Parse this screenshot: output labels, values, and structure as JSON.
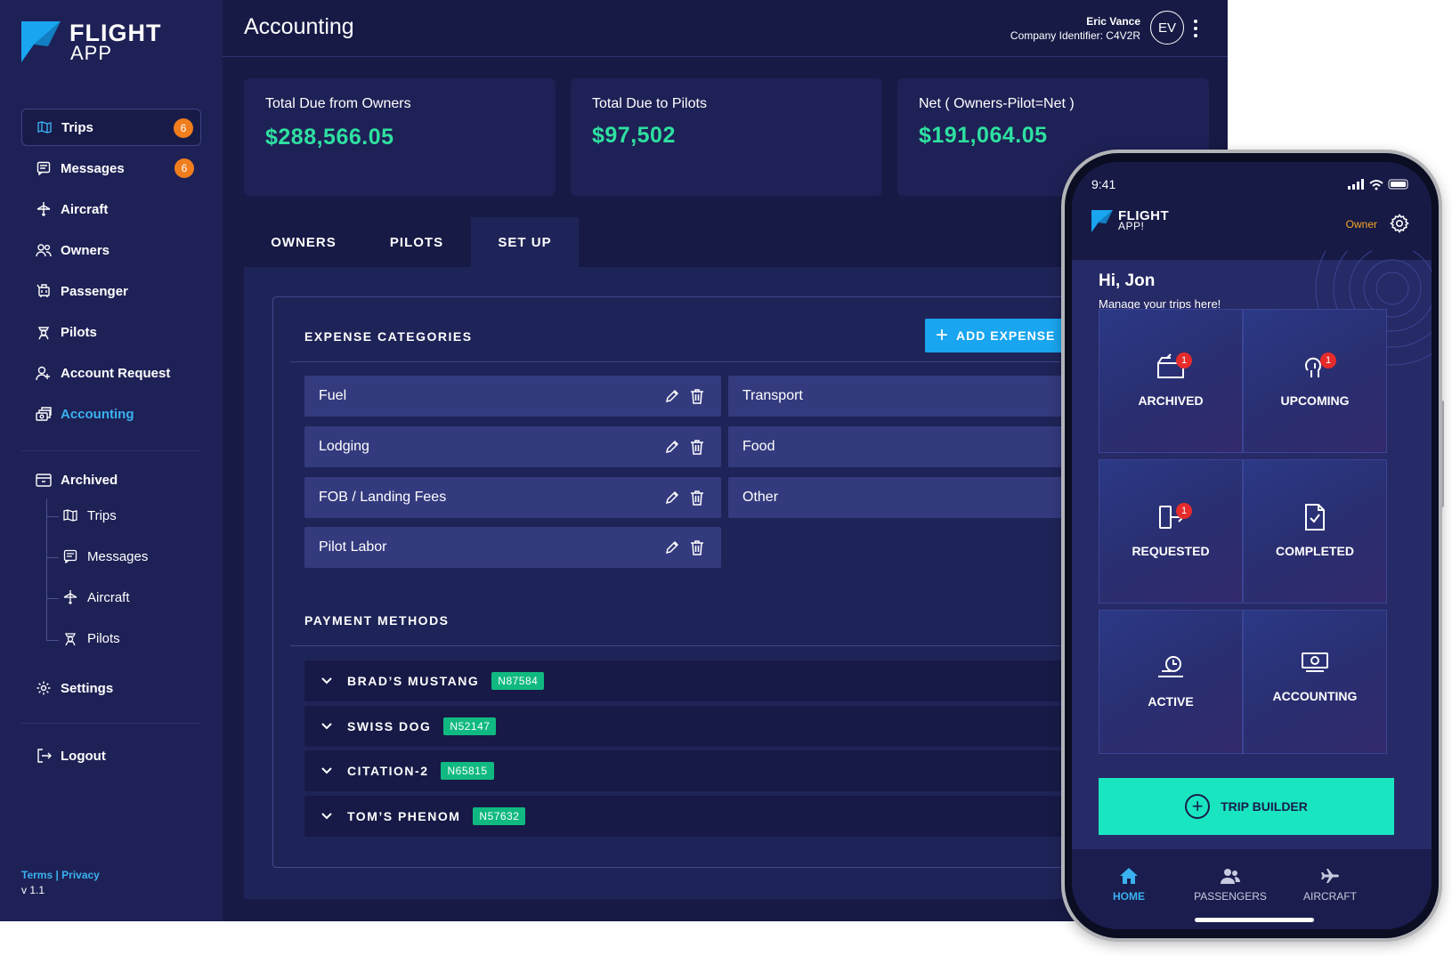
{
  "app": {
    "logo_line1": "FLIGHT",
    "logo_line2": "APP"
  },
  "sidebar": {
    "items": [
      {
        "label": "Trips",
        "badge": "6"
      },
      {
        "label": "Messages",
        "badge": "6"
      },
      {
        "label": "Aircraft"
      },
      {
        "label": "Owners"
      },
      {
        "label": "Passenger"
      },
      {
        "label": "Pilots"
      },
      {
        "label": "Account Request"
      },
      {
        "label": "Accounting"
      }
    ],
    "archived": {
      "label": "Archived",
      "children": [
        "Trips",
        "Messages",
        "Aircraft",
        "Pilots"
      ]
    },
    "settings": "Settings",
    "logout": "Logout",
    "footer_links": "Terms | Privacy",
    "version": "v 1.1"
  },
  "header": {
    "title": "Accounting",
    "user_name": "Eric Vance",
    "company_id": "Company Identifier: C4V2R",
    "avatar": "EV"
  },
  "stats": [
    {
      "label": "Total Due from Owners",
      "value": "$288,566.05"
    },
    {
      "label": "Total Due to Pilots",
      "value": "$97,502"
    },
    {
      "label": "Net  ( Owners-Pilot=Net )",
      "value": "$191,064.05"
    }
  ],
  "tabs": [
    "OWNERS",
    "PILOTS",
    "SET UP"
  ],
  "expense": {
    "title": "EXPENSE CATEGORIES",
    "add_button": "ADD EXPENSE",
    "left": [
      "Fuel",
      "Lodging",
      "FOB / Landing Fees",
      "Pilot Labor"
    ],
    "right": [
      "Transport",
      "Food",
      "Other"
    ]
  },
  "payment": {
    "title": "PAYMENT METHODS",
    "rows": [
      {
        "name": "BRAD’S MUSTANG",
        "tail": "N87584"
      },
      {
        "name": "SWISS DOG",
        "tail": "N52147"
      },
      {
        "name": "CITATION-2",
        "tail": "N65815"
      },
      {
        "name": "TOM’S PHENOM",
        "tail": "N57632"
      }
    ]
  },
  "phone": {
    "time": "9:41",
    "logo_line1": "FLIGHT",
    "logo_line2": "APP!",
    "role": "Owner",
    "greeting": "Hi, Jon",
    "subtitle": "Manage your trips here!",
    "tiles": [
      {
        "label": "ARCHIVED",
        "badge": "1",
        "icon": "archive-icon"
      },
      {
        "label": "UPCOMING",
        "badge": "1",
        "icon": "upcoming-icon"
      },
      {
        "label": "REQUESTED",
        "badge": "1",
        "icon": "requested-icon"
      },
      {
        "label": "COMPLETED",
        "icon": "completed-icon"
      },
      {
        "label": "ACTIVE",
        "icon": "active-icon"
      },
      {
        "label": "ACCOUNTING",
        "icon": "accounting-icon"
      }
    ],
    "trip_builder": "TRIP BUILDER",
    "nav": [
      "HOME",
      "PASSENGERS",
      "AIRCRAFT"
    ]
  },
  "colors": {
    "background": "#171a45",
    "sidebar": "#1e2155",
    "accent": "#3ab1f0",
    "money": "#2ee0a0",
    "badge": "#f07d1e",
    "tail": "#10b981",
    "trip_builder": "#19e5c0"
  }
}
